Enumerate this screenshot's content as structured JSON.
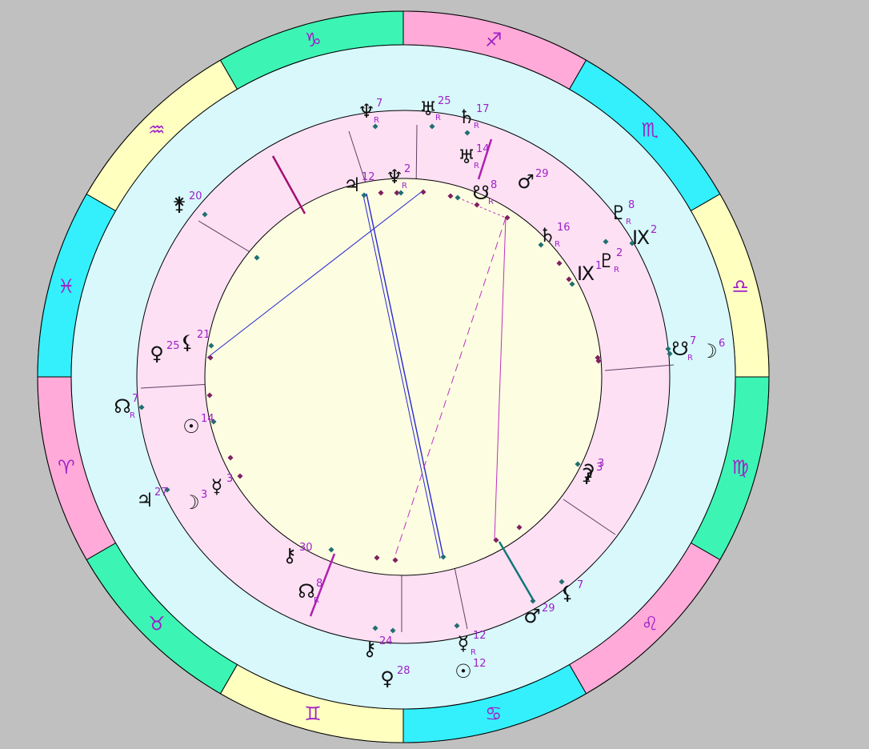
{
  "colors": {
    "background": "#c0c0c0",
    "outer_ring": "#d8f8fc",
    "house_ring": "#fde0f4",
    "center": "#fdfde2",
    "sign_fire": "#ffaad8",
    "sign_earth": "#3cf5b4",
    "sign_air": "#ffffc0",
    "sign_water": "#33f0fc",
    "sign_glyph": "#a020c8",
    "planet_glyph": "#101010",
    "degree_label": "#a020c8",
    "dot_outer": "#207070",
    "dot_inner": "#802060",
    "aspect_blue": "#2828d0",
    "aspect_magenta": "#c030c0",
    "axis_line": "#a01070",
    "axis_teal": "#107878"
  },
  "zodiac_signs": [
    {
      "name": "capricorn-sign",
      "glyph": "♑",
      "element": "earth"
    },
    {
      "name": "sagittarius-sign",
      "glyph": "♐",
      "element": "fire"
    },
    {
      "name": "scorpio-sign",
      "glyph": "♏",
      "element": "water"
    },
    {
      "name": "libra-sign",
      "glyph": "♎",
      "element": "air"
    },
    {
      "name": "virgo-sign",
      "glyph": "♍",
      "element": "earth"
    },
    {
      "name": "leo-sign",
      "glyph": "♌",
      "element": "fire"
    },
    {
      "name": "cancer-sign",
      "glyph": "♋",
      "element": "water"
    },
    {
      "name": "gemini-sign",
      "glyph": "♊",
      "element": "air"
    },
    {
      "name": "taurus-sign",
      "glyph": "♉",
      "element": "earth"
    },
    {
      "name": "aries-sign",
      "glyph": "♈",
      "element": "fire"
    },
    {
      "name": "pisces-sign",
      "glyph": "♓",
      "element": "water"
    },
    {
      "name": "aquarius-sign",
      "glyph": "♒",
      "element": "air"
    }
  ],
  "outer_planets": [
    {
      "name": "neptune",
      "glyph": "♆",
      "deg": "7",
      "retro": "R"
    },
    {
      "name": "uranus",
      "glyph": "♅",
      "deg": "25",
      "retro": "R"
    },
    {
      "name": "saturn",
      "glyph": "♄",
      "deg": "17",
      "retro": "R"
    },
    {
      "name": "pluto",
      "glyph": "♇",
      "deg": "8",
      "retro": "R"
    },
    {
      "name": "vertex",
      "glyph": "Ⅸ",
      "deg": "2",
      "retro": ""
    },
    {
      "name": "south-node",
      "glyph": "☋",
      "deg": "7",
      "retro": "R"
    },
    {
      "name": "moon",
      "glyph": "☽",
      "deg": "6",
      "retro": ""
    },
    {
      "name": "ceres",
      "glyph": "⚳",
      "deg": "3",
      "retro": ""
    },
    {
      "name": "lilith",
      "glyph": "⚸",
      "deg": "7",
      "retro": ""
    },
    {
      "name": "mars",
      "glyph": "♂",
      "deg": "29",
      "retro": ""
    },
    {
      "name": "mercury",
      "glyph": "☿",
      "deg": "12",
      "retro": "R"
    },
    {
      "name": "sun",
      "glyph": "☉",
      "deg": "12",
      "retro": ""
    },
    {
      "name": "venus",
      "glyph": "♀",
      "deg": "28",
      "retro": ""
    },
    {
      "name": "chiron",
      "glyph": "⚷",
      "deg": "24",
      "retro": ""
    },
    {
      "name": "jupiter",
      "glyph": "♃",
      "deg": "27",
      "retro": ""
    },
    {
      "name": "north-node",
      "glyph": "☊",
      "deg": "7",
      "retro": "R"
    },
    {
      "name": "juno",
      "glyph": "⚵",
      "deg": "20",
      "retro": ""
    }
  ],
  "inner_planets": [
    {
      "name": "jupiter",
      "glyph": "♃",
      "deg": "12",
      "retro": ""
    },
    {
      "name": "neptune",
      "glyph": "♆",
      "deg": "2",
      "retro": "R"
    },
    {
      "name": "uranus",
      "glyph": "♅",
      "deg": "14",
      "retro": "R"
    },
    {
      "name": "south-node",
      "glyph": "☋",
      "deg": "8",
      "retro": "R"
    },
    {
      "name": "mars",
      "glyph": "♂",
      "deg": "29",
      "retro": ""
    },
    {
      "name": "saturn",
      "glyph": "♄",
      "deg": "16",
      "retro": "R"
    },
    {
      "name": "pluto",
      "glyph": "♇",
      "deg": "2",
      "retro": "R"
    },
    {
      "name": "vertex",
      "glyph": "Ⅸ",
      "deg": "1",
      "retro": ""
    },
    {
      "name": "ceres",
      "glyph": "⚳",
      "deg": "3",
      "retro": ""
    },
    {
      "name": "north-node",
      "glyph": "☊",
      "deg": "8",
      "retro": "R"
    },
    {
      "name": "chiron",
      "glyph": "⚷",
      "deg": "30",
      "retro": ""
    },
    {
      "name": "moon",
      "glyph": "☽",
      "deg": "3",
      "retro": ""
    },
    {
      "name": "mercury",
      "glyph": "☿",
      "deg": "3",
      "retro": ""
    },
    {
      "name": "sun",
      "glyph": "☉",
      "deg": "14",
      "retro": ""
    },
    {
      "name": "venus",
      "glyph": "♀",
      "deg": "25",
      "retro": ""
    },
    {
      "name": "lilith",
      "glyph": "⚸",
      "deg": "21",
      "retro": ""
    }
  ]
}
